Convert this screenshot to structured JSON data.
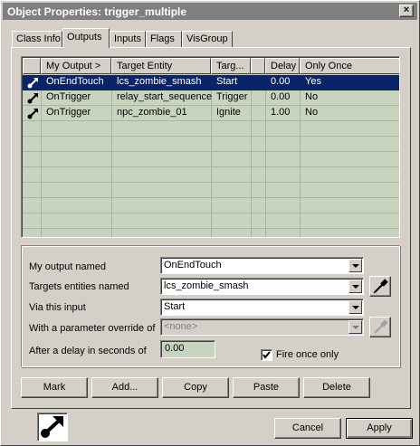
{
  "window": {
    "title": "Object Properties: trigger_multiple",
    "close_glyph": "×"
  },
  "tabs": [
    {
      "label": "Class Info"
    },
    {
      "label": "Outputs",
      "active": true
    },
    {
      "label": "Inputs"
    },
    {
      "label": "Flags"
    },
    {
      "label": "VisGroup"
    }
  ],
  "outputs_list": {
    "columns": [
      "My Output >",
      "Target Entity",
      "Targ...",
      "Delay",
      "Only Once"
    ],
    "rows": [
      {
        "icon": "output-arrow-icon",
        "output": "OnEndTouch",
        "target": "lcs_zombie_smash",
        "input": "Start",
        "delay": "0.00",
        "once": "Yes",
        "selected": true
      },
      {
        "icon": "output-arrow-icon",
        "output": "OnTrigger",
        "target": "relay_start_sequence",
        "input": "Trigger",
        "delay": "0.00",
        "once": "No",
        "selected": false
      },
      {
        "icon": "output-arrow-icon",
        "output": "OnTrigger",
        "target": "npc_zombie_01",
        "input": "Ignite",
        "delay": "1.00",
        "once": "No",
        "selected": false
      }
    ]
  },
  "form": {
    "output_label": "My output named",
    "output_value": "OnEndTouch",
    "targets_label": "Targets entities named",
    "targets_value": "lcs_zombie_smash",
    "input_label": "Via this input",
    "input_value": "Start",
    "param_label": "With a parameter override of",
    "param_value": "<none>",
    "delay_label": "After a delay in seconds of",
    "delay_value": "0.00",
    "fire_once_label": "Fire once only",
    "fire_once_checked": true
  },
  "buttons": {
    "mark": "Mark",
    "add": "Add...",
    "copy": "Copy",
    "paste": "Paste",
    "delete": "Delete",
    "cancel": "Cancel",
    "apply": "Apply"
  },
  "colors": {
    "selected_row": "#0a246a",
    "list_bg": "#c8d4c0",
    "face": "#d4d0c8"
  }
}
